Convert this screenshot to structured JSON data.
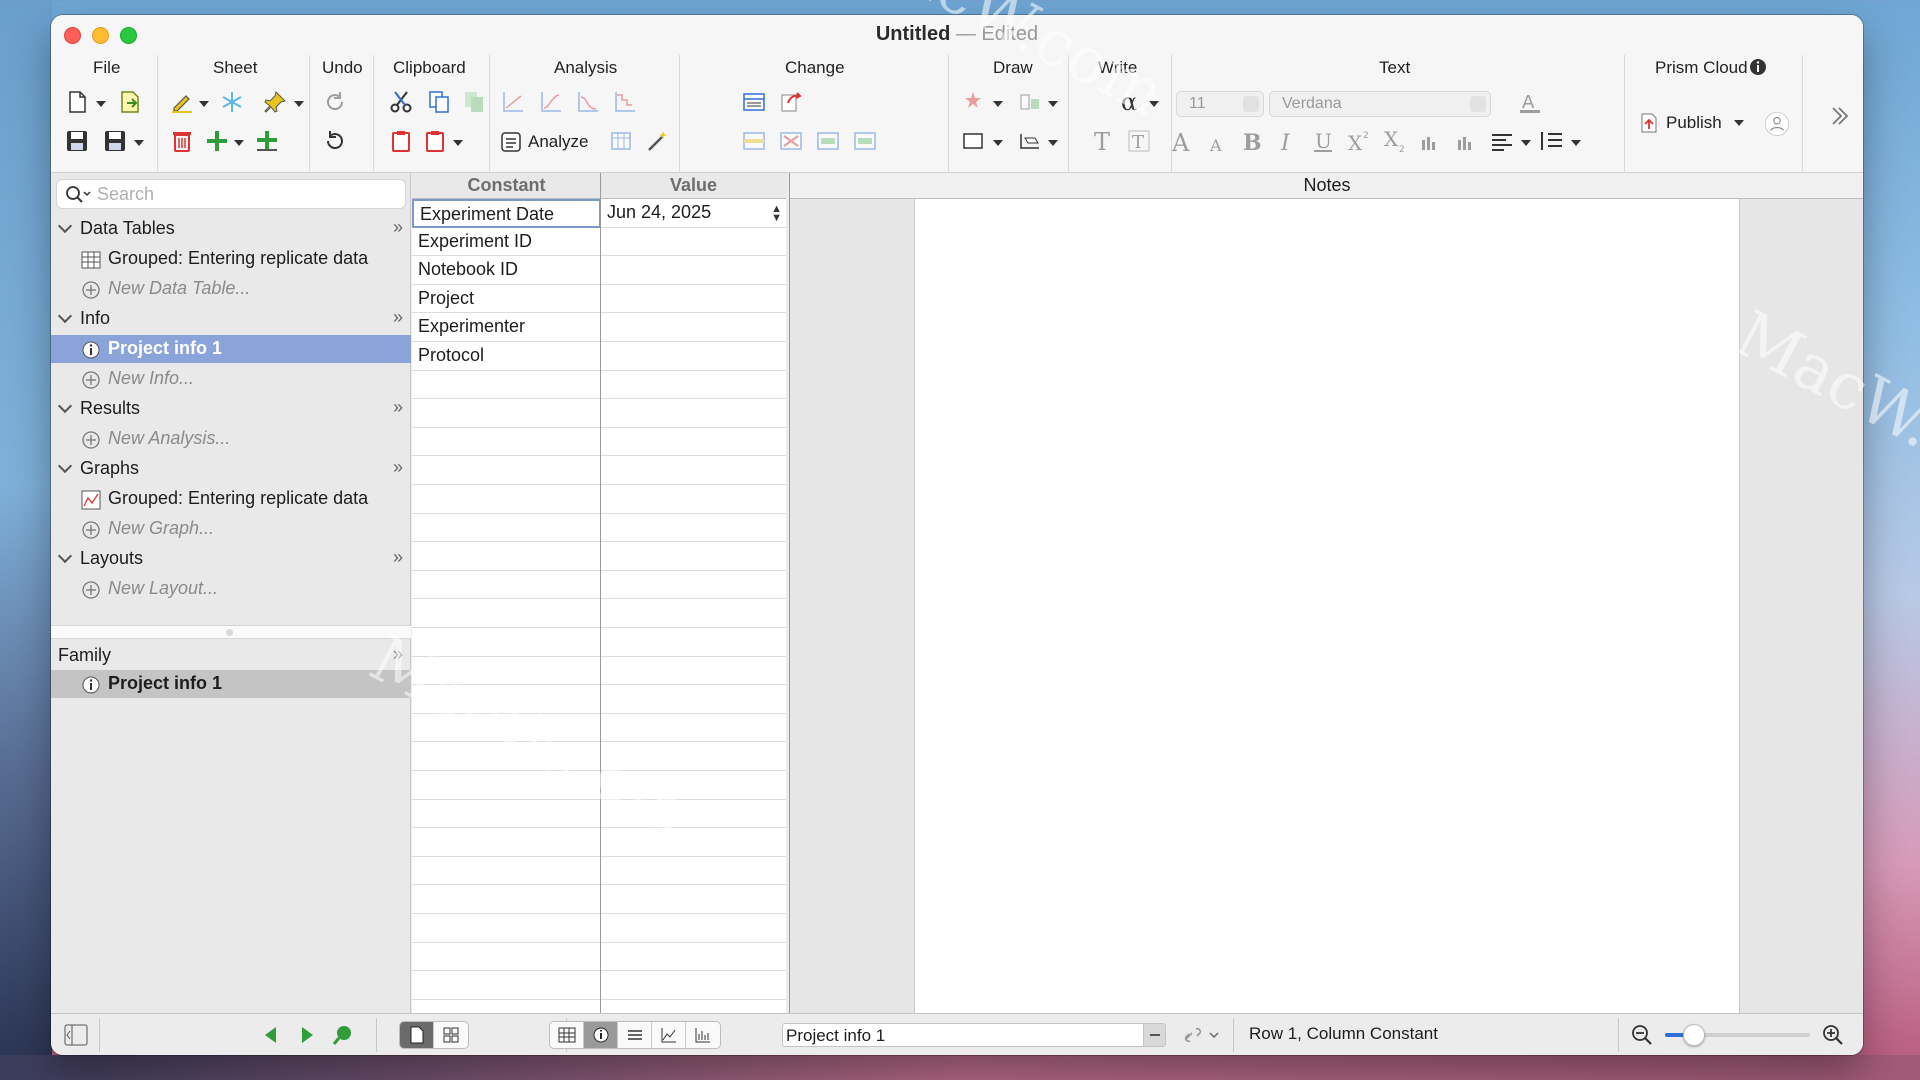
{
  "window": {
    "title": "Untitled",
    "title_suffix": "— Edited"
  },
  "toolbar": {
    "groups": {
      "file": "File",
      "sheet": "Sheet",
      "undo": "Undo",
      "clipboard": "Clipboard",
      "analysis": "Analysis",
      "change": "Change",
      "draw": "Draw",
      "write": "Write",
      "text": "Text",
      "prism_cloud": "Prism Cloud"
    },
    "analyze_label": "Analyze",
    "publish_label": "Publish",
    "font_size": "11",
    "font_name": "Verdana"
  },
  "sidebar": {
    "search_placeholder": "Search",
    "sections": {
      "data_tables": "Data Tables",
      "info": "Info",
      "results": "Results",
      "graphs": "Graphs",
      "layouts": "Layouts",
      "family": "Family"
    },
    "items": {
      "data_table_1": "Grouped: Entering replicate data",
      "new_data_table": "New Data Table...",
      "info_1": "Project info 1",
      "new_info": "New Info...",
      "new_analysis": "New Analysis...",
      "graph_1": "Grouped: Entering replicate data",
      "new_graph": "New Graph...",
      "new_layout": "New Layout...",
      "family_item": "Project info 1"
    },
    "more_glyph": "»"
  },
  "table": {
    "headers": {
      "constant": "Constant",
      "value": "Value"
    },
    "rows": [
      {
        "constant": "Experiment Date",
        "value": "Jun 24, 2025"
      },
      {
        "constant": "Experiment ID",
        "value": ""
      },
      {
        "constant": "Notebook ID",
        "value": ""
      },
      {
        "constant": "Project",
        "value": ""
      },
      {
        "constant": "Experimenter",
        "value": ""
      },
      {
        "constant": "Protocol",
        "value": ""
      }
    ]
  },
  "notes": {
    "header": "Notes"
  },
  "statusbar": {
    "sheet_name": "Project info 1",
    "status_text": "Row 1, Column Constant",
    "zoom_level": 0.2
  },
  "watermark": "MacW.com",
  "colors": {
    "accent": "#2f6fd6",
    "selection": "#8aa4d9",
    "window_bg": "#ececec"
  }
}
